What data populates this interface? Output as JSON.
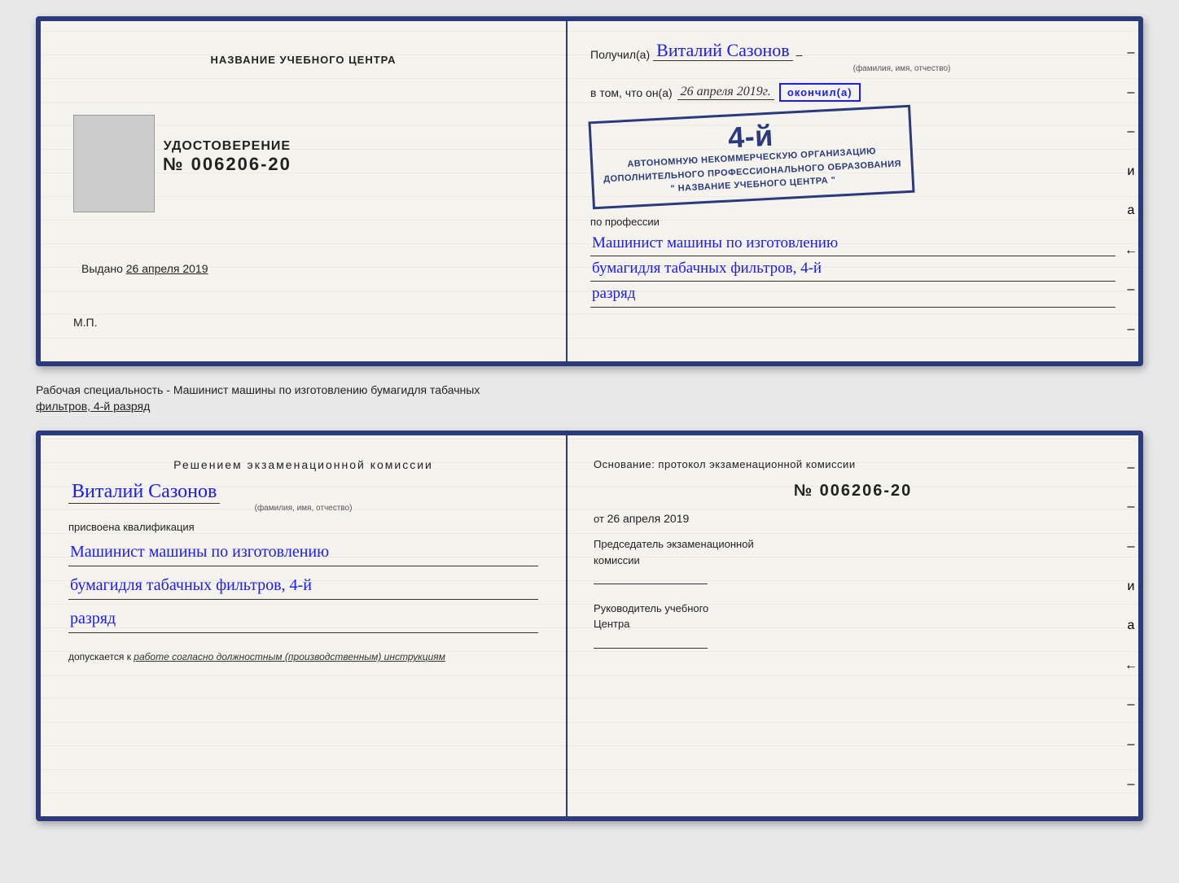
{
  "topCert": {
    "left": {
      "heading": "НАЗВАНИЕ УЧЕБНОГО ЦЕНТРА",
      "udostLabel": "УДОСТОВЕРЕНИЕ",
      "numberPrefix": "№",
      "number": "006206-20",
      "issuedLabel": "Выдано",
      "issuedDate": "26 апреля 2019",
      "mpLabel": "М.П."
    },
    "right": {
      "poluchilPrefix": "Получил(а)",
      "recipientName": "Виталий Сазонов",
      "fioLabel": "(фамилия, имя, отчество)",
      "dash1": "–",
      "vtomChto": "в том, что он(а)",
      "date": "26 апреля 2019г.",
      "okончilLabel": "окончил(а)",
      "stampNum": "4-й",
      "stampLine1": "АВТОНОМНУЮ НЕКОММЕРЧЕСКУЮ ОРГАНИЗАЦИЮ",
      "stampLine2": "ДОПОЛНИТЕЛЬНОГО ПРОФЕССИОНАЛЬНОГО ОБРАЗОВАНИЯ",
      "stampLine3": "\" НАЗВАНИЕ УЧЕБНОГО ЦЕНТРА \"",
      "poProfessii": "по профессии",
      "profLine1": "Машинист машины по изготовлению",
      "profLine2": "бумагидля табачных фильтров, 4-й",
      "profLine3": "разряд"
    }
  },
  "labelRow": {
    "text": "Рабочая специальность - Машинист машины по изготовлению бумагидля табачных",
    "underlineText": "фильтров, 4-й разряд"
  },
  "bottomCert": {
    "left": {
      "heading": "Решением  экзаменационной  комиссии",
      "recipientName": "Виталий Сазонов",
      "fioLabel": "(фамилия, имя, отчество)",
      "prisvoena": "присвоена квалификация",
      "qualLine1": "Машинист машины по изготовлению",
      "qualLine2": "бумагидля табачных фильтров, 4-й",
      "qualLine3": "разряд",
      "dopuskaetsya": "допускается к",
      "dopuskText": "работе согласно должностным (производственным) инструкциям"
    },
    "right": {
      "osnovanie": "Основание: протокол экзаменационной  комиссии",
      "numberPrefix": "№",
      "number": "006206-20",
      "otPrefix": "от",
      "date": "26 апреля 2019",
      "predsedatelLabel": "Председатель экзаменационной",
      "predsedatelLabel2": "комиссии",
      "rukovoditelLabel": "Руководитель учебного",
      "rukovoditelLabel2": "Центра"
    },
    "sideItems": [
      "–",
      "–",
      "–",
      "и",
      "а",
      "←",
      "–",
      "–",
      "–",
      "–",
      "–"
    ]
  }
}
